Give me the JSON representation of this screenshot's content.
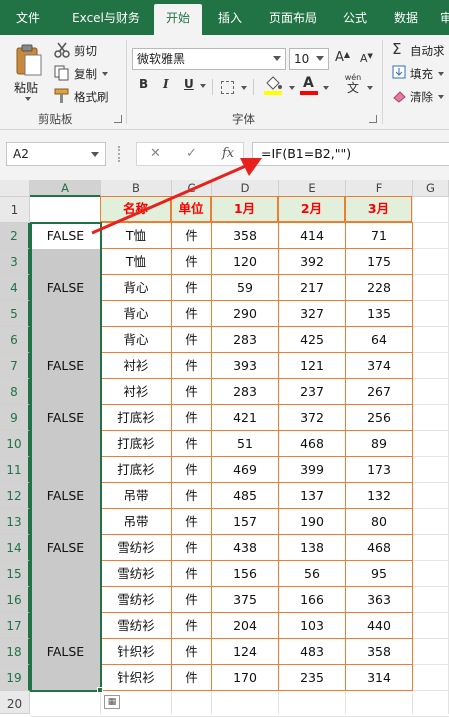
{
  "ribbon_tabs": [
    "文件",
    "Excel与财务",
    "开始",
    "插入",
    "页面布局",
    "公式",
    "数据",
    "审"
  ],
  "active_tab": "开始",
  "clipboard": {
    "paste_label": "粘贴",
    "cut_label": "剪切",
    "copy_label": "复制",
    "format_painter_label": "格式刷",
    "group_label": "剪贴板"
  },
  "font": {
    "font_name": "微软雅黑",
    "font_size": "10",
    "bold": "B",
    "italic": "I",
    "underline": "U",
    "font_color_glyph": "A",
    "phonetic_top": "wén",
    "phonetic_bottom": "文",
    "group_label": "字体"
  },
  "editing": {
    "autosum_label": "自动求",
    "fill_label": "填充",
    "clear_label": "清除"
  },
  "formula_bar": {
    "name_box": "A2",
    "formula": "=IF(B1=B2,\"\")"
  },
  "columns": [
    "A",
    "B",
    "C",
    "D",
    "E",
    "F",
    "G"
  ],
  "rows": [
    "1",
    "2",
    "3",
    "4",
    "5",
    "6",
    "7",
    "8",
    "9",
    "10",
    "11",
    "12",
    "13",
    "14",
    "15",
    "16",
    "17",
    "18",
    "19",
    "20"
  ],
  "table_header": [
    "名称",
    "单位",
    "1月",
    "2月",
    "3月"
  ],
  "table_rows": [
    [
      "T恤",
      "件",
      "358",
      "414",
      "71"
    ],
    [
      "T恤",
      "件",
      "120",
      "392",
      "175"
    ],
    [
      "背心",
      "件",
      "59",
      "217",
      "228"
    ],
    [
      "背心",
      "件",
      "290",
      "327",
      "135"
    ],
    [
      "背心",
      "件",
      "283",
      "425",
      "64"
    ],
    [
      "衬衫",
      "件",
      "393",
      "121",
      "374"
    ],
    [
      "衬衫",
      "件",
      "283",
      "237",
      "267"
    ],
    [
      "打底衫",
      "件",
      "421",
      "372",
      "256"
    ],
    [
      "打底衫",
      "件",
      "51",
      "468",
      "89"
    ],
    [
      "打底衫",
      "件",
      "469",
      "399",
      "173"
    ],
    [
      "吊带",
      "件",
      "485",
      "137",
      "132"
    ],
    [
      "吊带",
      "件",
      "157",
      "190",
      "80"
    ],
    [
      "雪纺衫",
      "件",
      "438",
      "138",
      "468"
    ],
    [
      "雪纺衫",
      "件",
      "156",
      "56",
      "95"
    ],
    [
      "雪纺衫",
      "件",
      "375",
      "166",
      "363"
    ],
    [
      "雪纺衫",
      "件",
      "204",
      "103",
      "440"
    ],
    [
      "针织衫",
      "件",
      "124",
      "483",
      "358"
    ],
    [
      "针织衫",
      "件",
      "170",
      "235",
      "314"
    ]
  ],
  "col_a_values": [
    "FALSE",
    "",
    "FALSE",
    "",
    "",
    "FALSE",
    "",
    "FALSE",
    "",
    "",
    "FALSE",
    "",
    "FALSE",
    "",
    "",
    "",
    "FALSE",
    ""
  ],
  "colors": {
    "excel_green": "#217346",
    "header_fill": "#e2efda",
    "header_text": "#ff0000",
    "border_orange": "#ed7d31",
    "selection_gray": "#c9c9c9",
    "arrow_red": "#e8211c"
  }
}
